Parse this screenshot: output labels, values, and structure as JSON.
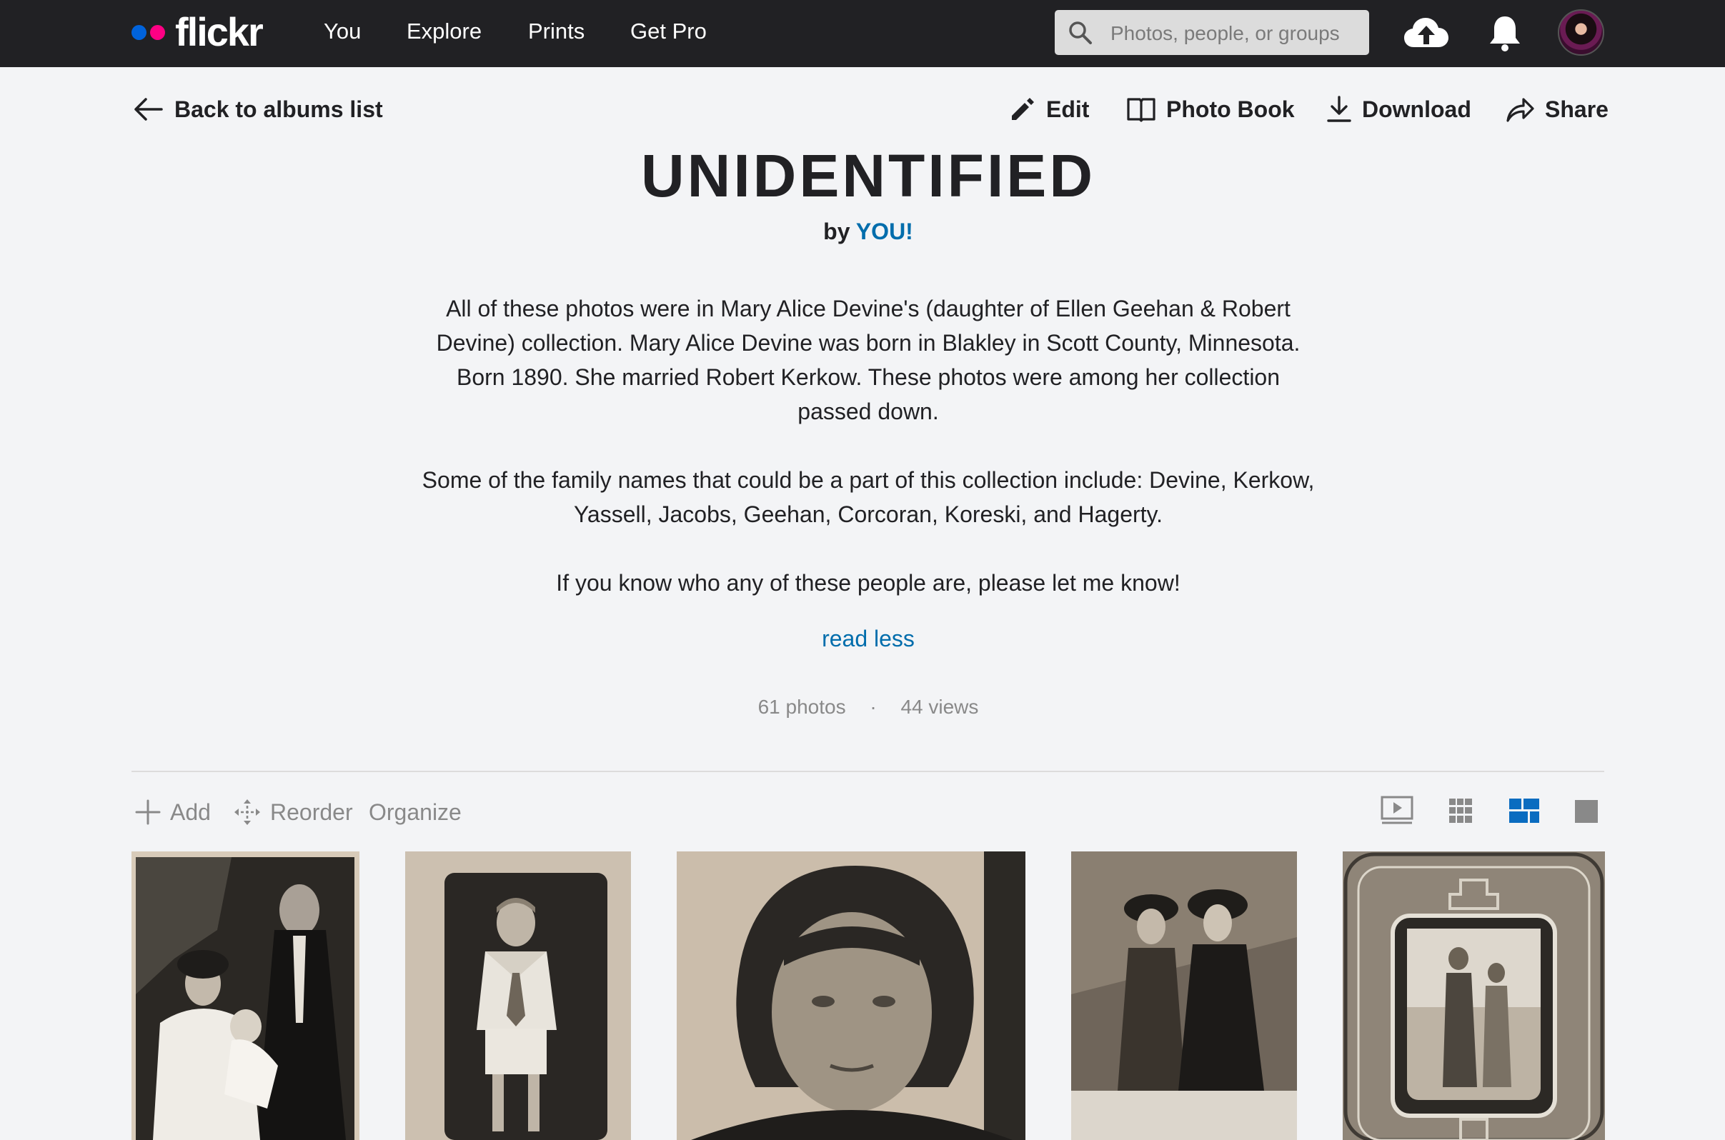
{
  "nav": {
    "logo": "flickr",
    "links": [
      "You",
      "Explore",
      "Prints",
      "Get Pro"
    ],
    "search_placeholder": "Photos, people, or groups",
    "icons": [
      "search-icon",
      "upload-cloud-icon",
      "notification-bell-icon",
      "user-avatar"
    ]
  },
  "actions": {
    "back": "Back to albums list",
    "edit": "Edit",
    "photo_book": "Photo Book",
    "download": "Download",
    "share": "Share"
  },
  "album": {
    "title": "UNIDENTIFIED",
    "by_prefix": "by",
    "owner": "YOU!",
    "description": [
      "All of these photos were in Mary Alice Devine's (daughter of Ellen Geehan & Robert Devine) collection. Mary Alice Devine was born in Blakley in Scott County, Minnesota. Born 1890. She married Robert Kerkow. These photos were among her collection passed down.",
      "Some of the family names that could be a part of this collection include: Devine, Kerkow, Yassell, Jacobs, Geehan, Corcoran, Koreski, and Hagerty.",
      "If you know who any of these people are, please let me know!"
    ],
    "read_less": "read less",
    "photos_count": "61 photos",
    "views_count": "44 views"
  },
  "toolbar": {
    "add": "Add",
    "reorder": "Reorder",
    "organize": "Organize",
    "views": [
      "slideshow-icon",
      "small-grid-icon",
      "justified-layout-icon",
      "single-photo-icon"
    ],
    "active_view": "justified-layout-icon"
  },
  "colors": {
    "nav_bg": "#212124",
    "page_bg": "#f3f4f6",
    "link_blue": "#006dac",
    "muted_gray": "#898989",
    "flickr_blue": "#0063dc",
    "flickr_pink": "#ff0084"
  }
}
